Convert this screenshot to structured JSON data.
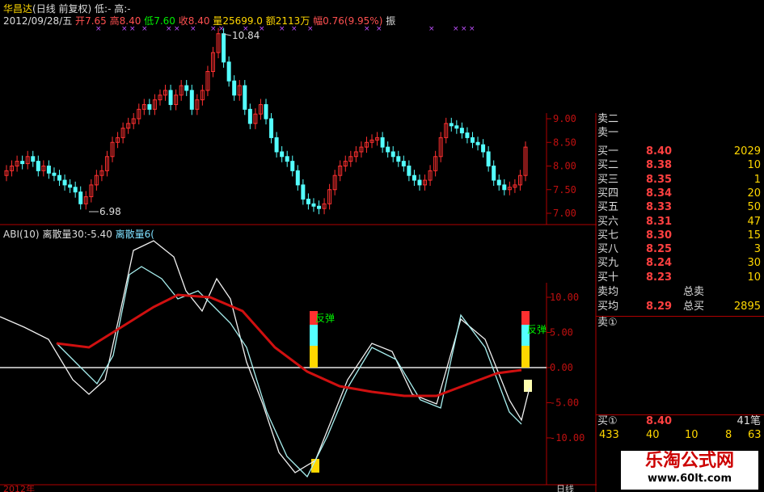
{
  "header": {
    "stock_name": "华昌达",
    "period": "(日线 前复权)",
    "low_label": "低:",
    "low_val": "-",
    "high_label": "高:",
    "high_val": "-",
    "date": "2012/09/28/五",
    "open_label": "开",
    "open": "7.65",
    "high2_label": "高",
    "high2": "8.40",
    "low2_label": "低",
    "low2": "7.60",
    "close_label": "收",
    "close": "8.40",
    "vol_label": "量",
    "vol": "25699.0",
    "amt_label": "额",
    "amt": "2113万",
    "chg_label": "幅",
    "chg": "0.76(9.95%)",
    "trailing": "振"
  },
  "price_chart": {
    "max_label": "10.84",
    "min_label": "6.98",
    "y_ticks": [
      "9.00",
      "8.50",
      "8.00",
      "7.50",
      "7.00"
    ]
  },
  "indicator": {
    "name": "ABI(10)",
    "series1_label": "离散量30:",
    "series1_value": "-5.40",
    "series2_label": "离散量6(",
    "y_ticks": [
      "10.00",
      "5.00",
      "0.00",
      "-5.00",
      "-10.00"
    ],
    "annot1": "反弹",
    "annot2": "反弹"
  },
  "quote": {
    "sell_rows": [
      {
        "label": "卖二",
        "price": "",
        "vol": ""
      },
      {
        "label": "卖一",
        "price": "",
        "vol": ""
      }
    ],
    "buy_rows": [
      {
        "label": "买一",
        "price": "8.40",
        "vol": "2029"
      },
      {
        "label": "买二",
        "price": "8.38",
        "vol": "10"
      },
      {
        "label": "买三",
        "price": "8.35",
        "vol": "1"
      },
      {
        "label": "买四",
        "price": "8.34",
        "vol": "20"
      },
      {
        "label": "买五",
        "price": "8.33",
        "vol": "50"
      },
      {
        "label": "买六",
        "price": "8.31",
        "vol": "47"
      },
      {
        "label": "买七",
        "price": "8.30",
        "vol": "15"
      },
      {
        "label": "买八",
        "price": "8.25",
        "vol": "3"
      },
      {
        "label": "买九",
        "price": "8.24",
        "vol": "30"
      },
      {
        "label": "买十",
        "price": "8.23",
        "vol": "10"
      }
    ],
    "sell_avg_label": "卖均",
    "total_sell_label": "总卖",
    "buy_avg_label": "买均",
    "buy_avg_price": "8.29",
    "total_buy_label": "总买",
    "total_buy_vol": "2895",
    "sell1_marker": "卖①",
    "buy1_marker": "买①",
    "buy1_price": "8.40",
    "buy1_count": "41笔",
    "tail": [
      "433",
      "40",
      "10",
      "8",
      "63"
    ]
  },
  "bottom": {
    "date_start": "2012年",
    "right_label": "日线"
  },
  "watermark": {
    "line1": "乐淘公式网",
    "line2": "www.60lt.com"
  },
  "colors": {
    "up": "#ff3030",
    "down": "#54ffff",
    "axis": "#c01010",
    "ma": "#d01010"
  }
}
